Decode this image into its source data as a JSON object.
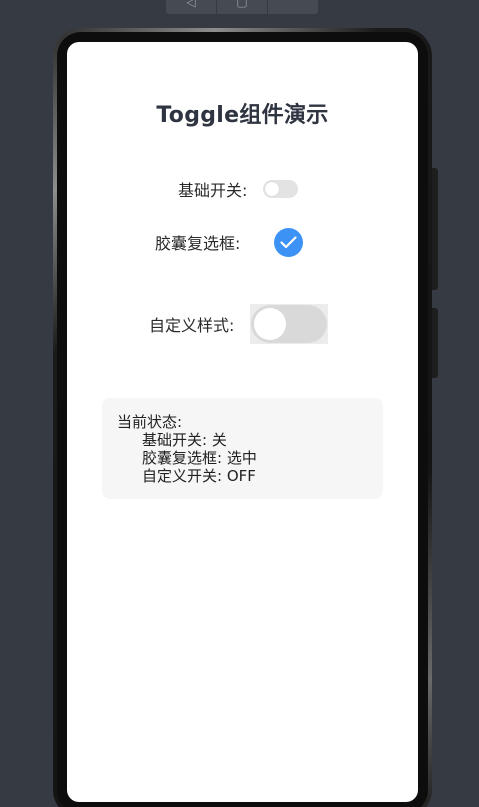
{
  "app": {
    "title": "Toggle组件演示"
  },
  "toggles": {
    "basic": {
      "label": "基础开关:",
      "on": false
    },
    "checkbox": {
      "label": "胶囊复选框:",
      "checked": true
    },
    "custom": {
      "label": "自定义样式:",
      "on": false
    }
  },
  "status": {
    "title": "当前状态:",
    "basic_line": "基础开关: 关",
    "checkbox_line": "胶囊复选框: 选中",
    "custom_line": "自定义开关: OFF"
  },
  "colors": {
    "accent": "#3d93f5",
    "switch_off": "#e3e3e3",
    "custom_switch_off": "#d9d9d9",
    "status_bg": "#f6f6f6",
    "title_text": "#2f3441"
  },
  "icons": {
    "checkmark": "checkmark-icon",
    "back": "back-icon",
    "window": "window-icon"
  }
}
